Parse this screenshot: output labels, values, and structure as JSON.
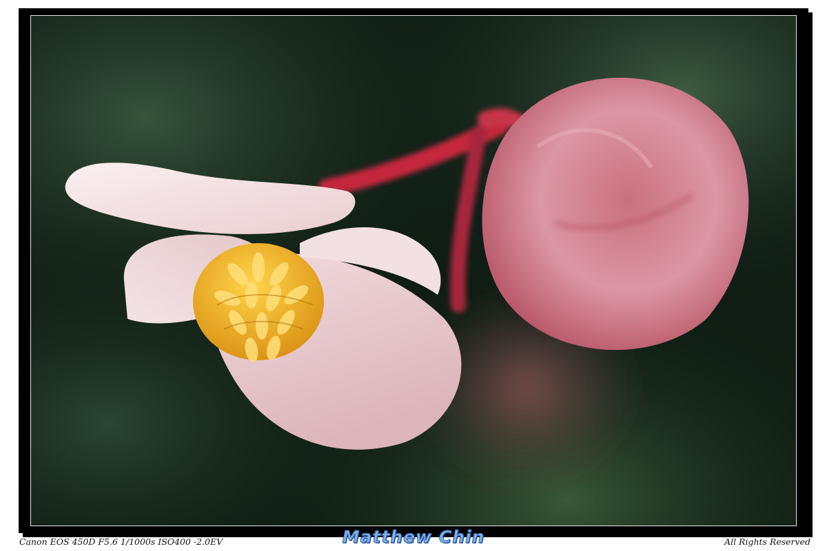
{
  "caption": {
    "camera_settings": "Canon EOS 450D F5.6 1/1000s ISO400 -2.0EV",
    "photographer": "Matthew Chin",
    "rights": "All Rights Reserved"
  },
  "colors": {
    "frame": "#000000",
    "background_dark": "#0c1a12",
    "background_green": "#2d4a33",
    "petal_white": "#f3e2e4",
    "bud_pink": "#d98896",
    "stamen_yellow": "#f0b82a",
    "stem_red": "#c4283e",
    "signature_blue": "#7fb0e6"
  }
}
